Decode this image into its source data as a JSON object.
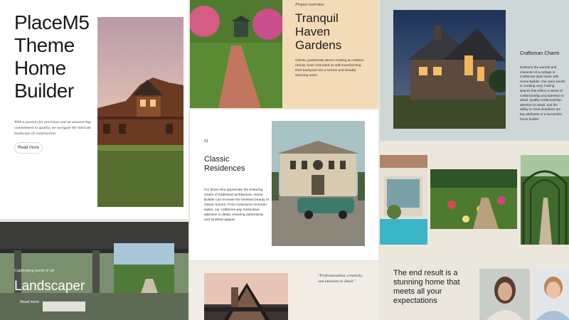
{
  "hero": {
    "title_lines": [
      "PlaceM5",
      "Theme",
      "Home",
      "Builder"
    ],
    "tagline": "With a passion for precision and an unwavering commitment to quality, we navigate the intricate landscape of construction.",
    "button": "Read more"
  },
  "landscaper": {
    "eyebrow": "Captivating world of art",
    "title": "Landscaper",
    "button": "Read more"
  },
  "tranquil": {
    "eyebrow": "Project overview",
    "title": "Tranquil Haven Gardens",
    "body": "Clients, passionate about creating an outdoor retreat, have entrusted us with transforming their backyard into a serene and visually stunning oasis."
  },
  "classic": {
    "number": "01",
    "title": "Classic Residences",
    "body": "For those who appreciate the enduring charm of traditional architecture, Home Builder can recreate the timeless beauty of classic homes. From Colonial to Victorian styles, our craftsmen pay meticulous attention to detail, ensuring authenticity and timeless appeal."
  },
  "quote": {
    "text": "\"Professionalism, creativity, and attention to detail.\""
  },
  "craftsman": {
    "title": "Craftsman Charm",
    "body": "Embrace the warmth and character of a cottage or Craftsman-style home with Home Builder. Our team excels in creating cozy, inviting spaces that reflect a sense of craftsmanship and attention to detail. Quality craftsmanship, attention to detail, and the ability to meet deadlines are key attributes of a successful home builder."
  },
  "result": {
    "title": "The end result is a stunning home that meets all your expectations"
  }
}
